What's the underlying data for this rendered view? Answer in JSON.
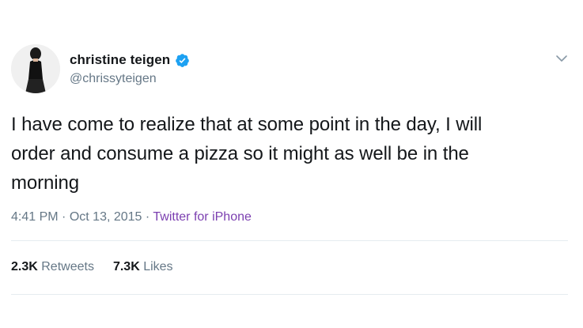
{
  "author": {
    "name": "christine teigen",
    "handle": "@chrissyteigen",
    "verified": true,
    "verified_icon": "verified-badge-icon"
  },
  "menu_icon": "chevron-down-icon",
  "tweet": {
    "text_lines": [
      "I have come to realize that at some point in the day, I will",
      "order and consume a pizza so it might as well be in the",
      "morning"
    ]
  },
  "meta": {
    "time": "4:41 PM",
    "separator": "·",
    "date": "Oct 13, 2015",
    "source": "Twitter for iPhone"
  },
  "stats": {
    "retweets_count": "2.3K",
    "retweets_label": "Retweets",
    "likes_count": "7.3K",
    "likes_label": "Likes"
  },
  "colors": {
    "text": "#14171a",
    "muted": "#657786",
    "verified": "#1da1f2",
    "source_link": "#7b3fb0",
    "divider": "#e6ecf0"
  }
}
